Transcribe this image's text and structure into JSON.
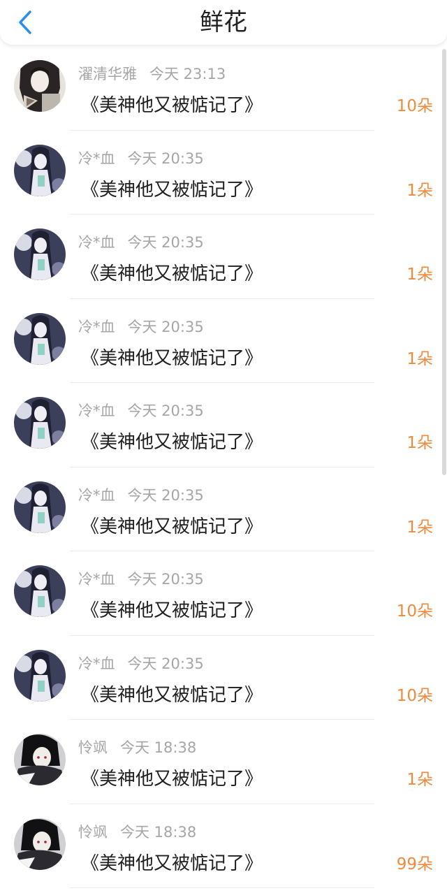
{
  "header": {
    "title": "鲜花",
    "back_icon": "chevron-left-icon"
  },
  "colors": {
    "accent": "#2f8ee8",
    "count": "#f08a3c",
    "meta": "#a6a6a6"
  },
  "items": [
    {
      "user": "濯清华雅",
      "time": "今天 23:13",
      "book": "《美神他又被惦记了》",
      "count": "10朵",
      "avatar": "a"
    },
    {
      "user": "冷*血",
      "time": "今天 20:35",
      "book": "《美神他又被惦记了》",
      "count": "1朵",
      "avatar": "b"
    },
    {
      "user": "冷*血",
      "time": "今天 20:35",
      "book": "《美神他又被惦记了》",
      "count": "1朵",
      "avatar": "b"
    },
    {
      "user": "冷*血",
      "time": "今天 20:35",
      "book": "《美神他又被惦记了》",
      "count": "1朵",
      "avatar": "b"
    },
    {
      "user": "冷*血",
      "time": "今天 20:35",
      "book": "《美神他又被惦记了》",
      "count": "1朵",
      "avatar": "b"
    },
    {
      "user": "冷*血",
      "time": "今天 20:35",
      "book": "《美神他又被惦记了》",
      "count": "1朵",
      "avatar": "b"
    },
    {
      "user": "冷*血",
      "time": "今天 20:35",
      "book": "《美神他又被惦记了》",
      "count": "10朵",
      "avatar": "b"
    },
    {
      "user": "冷*血",
      "time": "今天 20:35",
      "book": "《美神他又被惦记了》",
      "count": "10朵",
      "avatar": "b"
    },
    {
      "user": "怜飒",
      "time": "今天 18:38",
      "book": "《美神他又被惦记了》",
      "count": "1朵",
      "avatar": "c"
    },
    {
      "user": "怜飒",
      "time": "今天 18:38",
      "book": "《美神他又被惦记了》",
      "count": "99朵",
      "avatar": "c"
    }
  ]
}
